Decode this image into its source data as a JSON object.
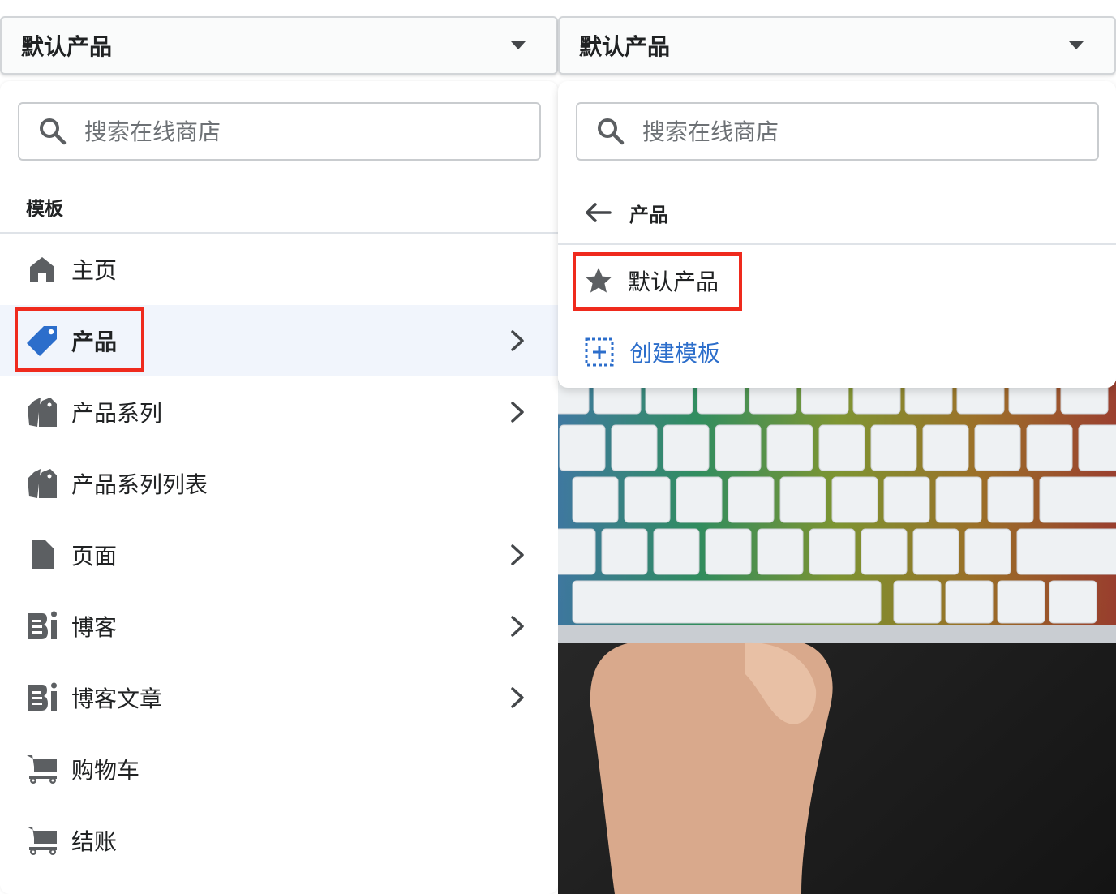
{
  "left": {
    "select": {
      "value": "默认产品"
    },
    "search": {
      "placeholder": "搜索在线商店"
    },
    "section_title": "模板",
    "items": [
      {
        "label": "主页",
        "icon": "home-icon",
        "has_chevron": false
      },
      {
        "label": "产品",
        "icon": "tag-icon",
        "has_chevron": true,
        "active": true
      },
      {
        "label": "产品系列",
        "icon": "tags-icon",
        "has_chevron": true
      },
      {
        "label": "产品系列列表",
        "icon": "tags-icon",
        "has_chevron": false
      },
      {
        "label": "页面",
        "icon": "page-icon",
        "has_chevron": true
      },
      {
        "label": "博客",
        "icon": "blog-icon",
        "has_chevron": true
      },
      {
        "label": "博客文章",
        "icon": "blog-icon",
        "has_chevron": true
      },
      {
        "label": "购物车",
        "icon": "cart-icon",
        "has_chevron": false
      },
      {
        "label": "结账",
        "icon": "cart-icon",
        "has_chevron": false
      }
    ]
  },
  "right": {
    "select": {
      "value": "默认产品"
    },
    "search": {
      "placeholder": "搜索在线商店"
    },
    "back_label": "产品",
    "templates": [
      {
        "label": "默认产品",
        "icon": "star-icon"
      }
    ],
    "create_label": "创建模板"
  },
  "colors": {
    "accent_blue": "#2c6ecb",
    "highlight_red": "#ef2a1d",
    "active_bg": "#f1f5fc",
    "icon_gray": "#5c5f62"
  }
}
